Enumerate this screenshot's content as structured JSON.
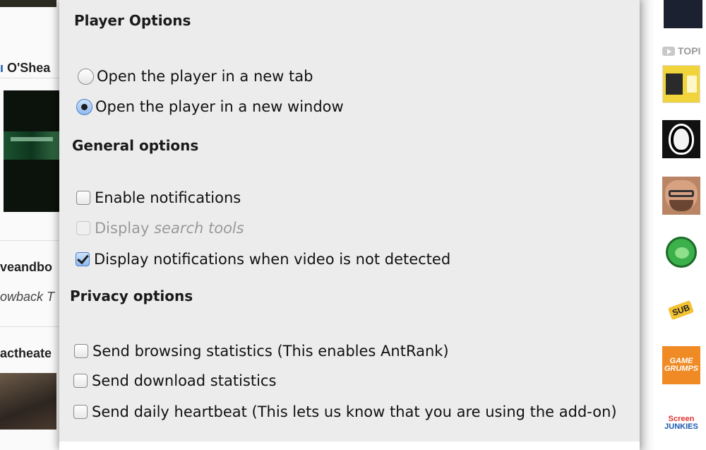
{
  "background_left": {
    "names": [
      "O'Shea",
      "veandbo",
      "owback T",
      "actheate"
    ]
  },
  "background_right": {
    "topics_label": "TOPI",
    "channel_logos": [
      "SUB",
      "GAME GRUMPS",
      "Screen",
      "JUNKIES"
    ]
  },
  "dialog": {
    "player_section": {
      "title": "Player Options",
      "options": [
        {
          "label": "Open the player in a new tab",
          "selected": false
        },
        {
          "label": "Open the player in a new window",
          "selected": true
        }
      ]
    },
    "general_section": {
      "title": "General options",
      "options": [
        {
          "label": "Enable notifications",
          "checked": false,
          "enabled": true
        },
        {
          "label_prefix": "Display ",
          "label_italic": "search tools",
          "checked": false,
          "enabled": false
        },
        {
          "label": "Display notifications when video is not detected",
          "checked": true,
          "enabled": true
        }
      ]
    },
    "privacy_section": {
      "title": "Privacy options",
      "options": [
        {
          "label": "Send browsing statistics (This enables AntRank)",
          "checked": false
        },
        {
          "label": "Send download statistics",
          "checked": false
        },
        {
          "label": "Send daily heartbeat (This lets us know that you are using the add-on)",
          "checked": false
        }
      ]
    }
  }
}
